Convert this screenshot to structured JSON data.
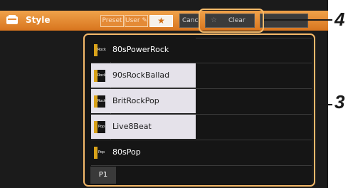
{
  "titlebar": {
    "title": "Style",
    "tabs": [
      "Preset",
      "User",
      "★"
    ],
    "cancel_label": "Cance",
    "clear_label": "Clear"
  },
  "styles": [
    {
      "name": "80sPowerRock",
      "icon_text": "Rock",
      "selected": false
    },
    {
      "name": "90sRockBallad",
      "icon_text": "Rock",
      "selected": true
    },
    {
      "name": "BritRockPop",
      "icon_text": "Rock",
      "selected": true
    },
    {
      "name": "Live8Beat",
      "icon_text": "Pop",
      "selected": true
    },
    {
      "name": "80sPop",
      "icon_text": "Pop",
      "selected": false
    }
  ],
  "page_tab": "P1",
  "callouts": {
    "top": "4",
    "right": "3"
  },
  "colors": {
    "accent": "#e48a36",
    "callout": "#f4b96a",
    "icon_gold": "#d9a21a"
  }
}
